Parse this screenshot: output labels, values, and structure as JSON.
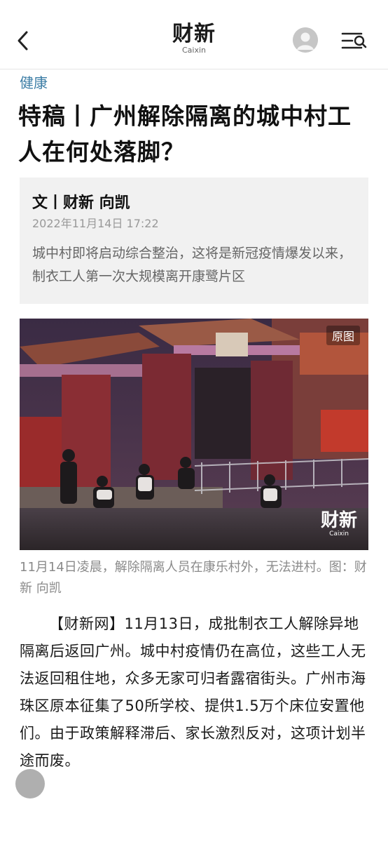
{
  "header": {
    "logo_cn": "财新",
    "logo_en": "Caixin"
  },
  "article": {
    "category": "健康",
    "title": "特稿丨广州解除隔离的城中村工人在何处落脚？",
    "byline": "文丨财新 向凯",
    "datetime": "2022年11月14日 17:22",
    "summary": "城中村即将启动综合整治，这将是新冠疫情爆发以来，制衣工人第一次大规模离开康鹭片区",
    "photo": {
      "badge": "原图",
      "watermark_cn": "财新",
      "watermark_en": "Caixin"
    },
    "caption": "11月14日凌晨，解除隔离人员在康乐村外，无法进村。图：财新 向凯",
    "body_source": "【财新网】",
    "body": "11月13日，成批制衣工人解除异地隔离后返回广州。城中村疫情仍在高位，这些工人无法返回租住地，众多无家可归者露宿街头。广州市海珠区原本征集了50所学校、提供1.5万个床位安置他们。由于政策解释滞后、家长激烈反对，这项计划半途而废。"
  }
}
